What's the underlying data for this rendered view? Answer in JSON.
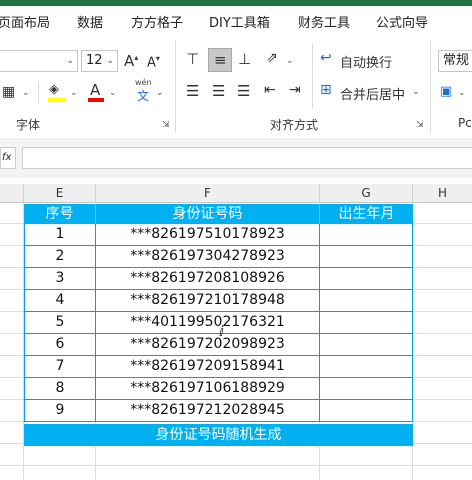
{
  "ribbon_tabs": [
    "页面布局",
    "数据",
    "方方格子",
    "DIY工具箱",
    "财务工具",
    "公式向导"
  ],
  "font": {
    "name_value": "",
    "size_value": "12",
    "grow_label": "A",
    "shrink_label": "A",
    "phonetic_label": "wén",
    "phonetic_char": "文",
    "group_label": "字体",
    "fill_color": "#ffff00",
    "font_color": "#ff0000"
  },
  "alignment": {
    "wrap_text_label": "自动换行",
    "merge_center_label": "合并后居中",
    "group_label": "对齐方式"
  },
  "number": {
    "format_value": "常规",
    "truncated_label": "Pc"
  },
  "columns": [
    "E",
    "F",
    "G",
    "H"
  ],
  "table": {
    "header": [
      "序号",
      "身份证号码",
      "出生年月"
    ],
    "rows": [
      {
        "no": "1",
        "id": "***826197510178923",
        "birth": ""
      },
      {
        "no": "2",
        "id": "***826197304278923",
        "birth": ""
      },
      {
        "no": "3",
        "id": "***826197208108926",
        "birth": ""
      },
      {
        "no": "4",
        "id": "***826197210178948",
        "birth": ""
      },
      {
        "no": "5",
        "id": "***401199502176321",
        "birth": ""
      },
      {
        "no": "6",
        "id": "***826197202098923",
        "birth": ""
      },
      {
        "no": "7",
        "id": "***826197209158941",
        "birth": ""
      },
      {
        "no": "8",
        "id": "***826197106188929",
        "birth": ""
      },
      {
        "no": "9",
        "id": "***826197212028945",
        "birth": ""
      }
    ],
    "footer": "身份证号码随机生成",
    "accent": "#00b0f0"
  }
}
